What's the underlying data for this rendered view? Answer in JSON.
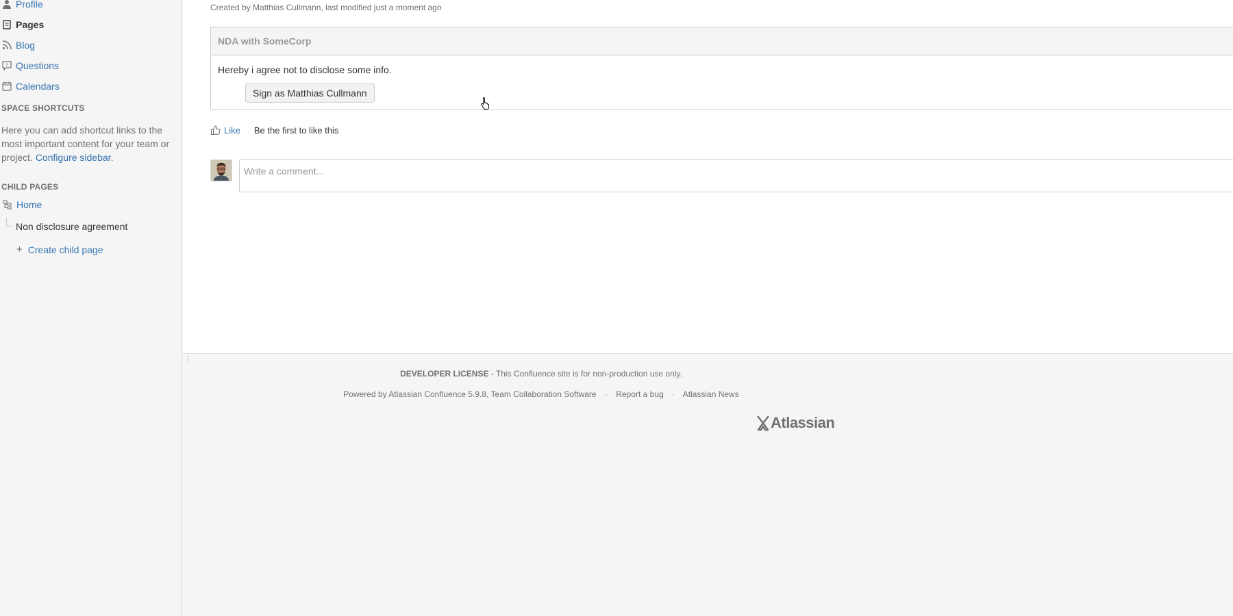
{
  "sidebar": {
    "nav": [
      {
        "label": "Profile",
        "icon": "person-icon"
      },
      {
        "label": "Pages",
        "icon": "pages-icon"
      },
      {
        "label": "Blog",
        "icon": "rss-icon"
      },
      {
        "label": "Questions",
        "icon": "question-icon"
      },
      {
        "label": "Calendars",
        "icon": "calendar-icon"
      }
    ],
    "shortcuts_heading": "SPACE SHORTCUTS",
    "shortcuts_text": "Here you can add shortcut links to the most important content for your team or project.",
    "configure_link": "Configure sidebar",
    "child_pages_heading": "CHILD PAGES",
    "child_home": "Home",
    "child_nda": "Non disclosure agreement",
    "create_child": "Create child page"
  },
  "page": {
    "meta_prefix": "Created by ",
    "meta_author": "Matthias Cullmann",
    "meta_middle": ", last modified ",
    "meta_time": "just a moment ago",
    "nda_title": "NDA with SomeCorp",
    "nda_text": "Hereby i agree not to disclose some info.",
    "sign_button": "Sign as Matthias Cullmann",
    "like_label": "Like",
    "like_first": "Be the first to like this",
    "comment_placeholder": "Write a comment..."
  },
  "footer": {
    "license_bold": "DEVELOPER LICENSE",
    "license_text": " - This Confluence site is for non-production use only.",
    "powered": "Powered by Atlassian Confluence 5.9.8, Team Collaboration Software",
    "report_bug": "Report a bug",
    "news": "Atlassian News",
    "logo_text": "Atlassian"
  },
  "colors": {
    "link": "#3572b0",
    "muted": "#707070",
    "background": "#f5f5f5"
  }
}
